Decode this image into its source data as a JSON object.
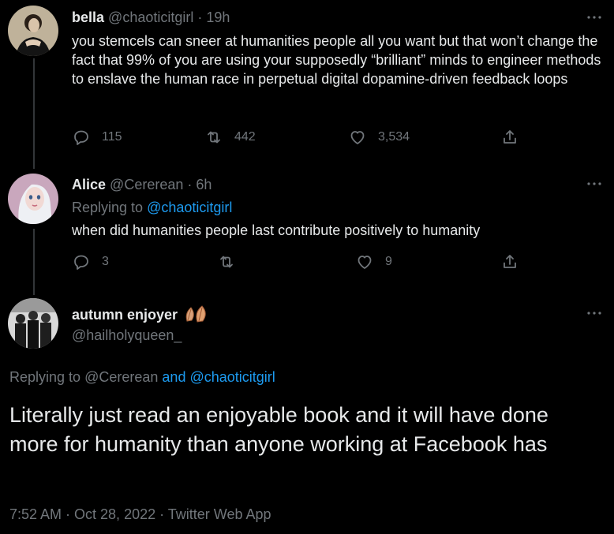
{
  "tweet1": {
    "name": "bella",
    "handle": "@chaoticitgirl",
    "time": "· 19h",
    "text": "you stemcels can sneer at humanities people all you want but that won’t change the fact that 99% of you are using your supposedly “brilliant” minds to engineer methods to enslave the human race in perpetual digital dopamine-driven feedback loops",
    "replies": "115",
    "retweets": "442",
    "likes": "3,534"
  },
  "tweet2": {
    "name": "Alice",
    "handle": "@Cererean",
    "time": "· 6h",
    "replying_prefix": "Replying to",
    "replying_to": "@chaoticitgirl",
    "text": "when did humanities people last contribute positively to humanity",
    "replies": "3",
    "retweets": "",
    "likes": "9"
  },
  "tweet3": {
    "name": "autumn enjoyer",
    "handle": "@hailholyqueen_",
    "replying_prefix": "Replying to",
    "replying_to_1": "@Cererean",
    "replying_and": "and",
    "replying_to_2": "@chaoticitgirl",
    "text": "Literally just read an enjoyable book and it will have done more for humanity than anyone working at Facebook has",
    "meta": "7:52 AM · Oct 28, 2022 · Twitter Web App"
  },
  "icons": [
    "reply-icon",
    "retweet-icon",
    "like-icon",
    "share-icon",
    "more-icon",
    "leaf-emoji-icon"
  ],
  "colors": {
    "background": "#000000",
    "text": "#e7e9ea",
    "muted": "#71767b",
    "link": "#1d9bf0"
  }
}
